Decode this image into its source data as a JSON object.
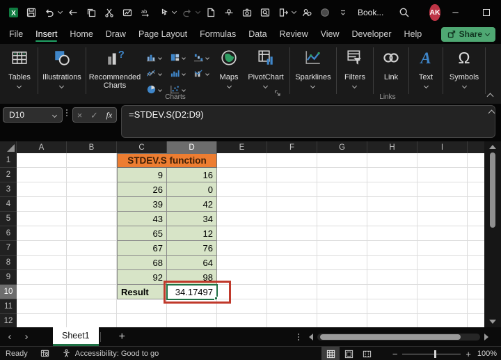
{
  "titlebar": {
    "title": "Book...",
    "avatar_initials": "AK",
    "avatar_color": "#BE3445"
  },
  "menu": {
    "tabs": [
      "File",
      "Insert",
      "Home",
      "Draw",
      "Page Layout",
      "Formulas",
      "Data",
      "Review",
      "View",
      "Developer",
      "Help"
    ],
    "active_tab": "Insert",
    "share_label": "Share"
  },
  "ribbon": {
    "tables_label": "Tables",
    "illustrations_label": "Illustrations",
    "recommended_charts_label": "Recommended Charts",
    "maps_label": "Maps",
    "pivotchart_label": "PivotChart",
    "sparklines_label": "Sparklines",
    "filters_label": "Filters",
    "link_label": "Link",
    "text_label": "Text",
    "symbols_label": "Symbols",
    "charts_group_label": "Charts",
    "links_group_label": "Links"
  },
  "formula_bar": {
    "name_box": "D10",
    "fx_label": "fx",
    "formula": "=STDEV.S(D2:D9)"
  },
  "grid": {
    "column_headers": [
      "A",
      "B",
      "C",
      "D",
      "E",
      "F",
      "G",
      "H",
      "I"
    ],
    "row_headers": [
      "1",
      "2",
      "3",
      "4",
      "5",
      "6",
      "7",
      "8",
      "9",
      "10",
      "11",
      "12"
    ],
    "selected_column": "D",
    "selected_row": "10",
    "selected_cell": "D10",
    "table": {
      "title": "STDEV.S function",
      "data": [
        [
          "9",
          "16"
        ],
        [
          "26",
          "0"
        ],
        [
          "39",
          "42"
        ],
        [
          "43",
          "34"
        ],
        [
          "65",
          "12"
        ],
        [
          "67",
          "76"
        ],
        [
          "68",
          "64"
        ],
        [
          "92",
          "98"
        ]
      ],
      "result_label": "Result",
      "result_value": "34.17497"
    },
    "colors": {
      "title_fill": "#ED7D31",
      "data_fill": "#D7E4C7",
      "selection_border": "#1E7145",
      "annotation_box": "#C0392B"
    }
  },
  "sheet_tabs": {
    "tabs": [
      "Sheet1"
    ],
    "active": "Sheet1"
  },
  "status_bar": {
    "mode": "Ready",
    "accessibility": "Accessibility: Good to go",
    "zoom_level": "100%"
  }
}
